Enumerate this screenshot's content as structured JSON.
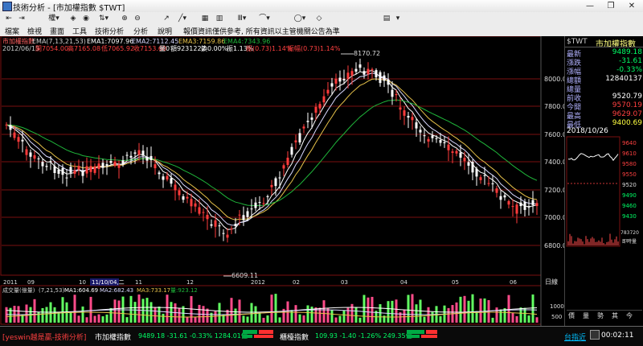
{
  "window": {
    "title": "技術分析 - [市加權指數 $TWT]",
    "min": "—",
    "max": "❐",
    "close": "✕"
  },
  "toolbar": {
    "items": [
      "⇤",
      "⇥",
      "權▾",
      "◈",
      "◉",
      "⇅▾",
      "⊕",
      "⊖",
      "↗",
      "╱▾",
      "▦",
      "▥",
      "Ⅲ▾",
      "⌒▾",
      "◯▾",
      "◇",
      "▤",
      "▾"
    ]
  },
  "menu": {
    "items": [
      "檔案",
      "檢視",
      "畫面",
      "工具",
      "技術分析",
      "分析",
      "說明",
      "報價資訊僅供參考, 所有資訊以主管機關公告為準"
    ]
  },
  "colors": {
    "up": "#ff3b3b",
    "down": "#ffffff",
    "ma1": "#ffffff",
    "ma2": "#d8d8ff",
    "ma3": "#e7c24a",
    "ma4": "#1fb53a",
    "grid": "#7a1010",
    "label": "#b2b2ff"
  },
  "price": {
    "header1": {
      "name": "市加權指數",
      "ema": "EMA(7,13,21,53)",
      "ema1": "EMA1:7097.96",
      "ema2": "EMA2:7112.45",
      "ema3": "EMA3:7159.86",
      "ema4": "EMA4:7343.96"
    },
    "header2": {
      "date": "2012/06/15",
      "open": "開7054.00",
      "high": "高7165.08",
      "low": "低7065.92",
      "close": "收7153.60",
      "vol": "量0",
      "amt": "額9231222",
      "chg": "換0.00%",
      "amp": "振1.13%",
      "ratio1": "振(0.73)1.14%",
      "ratio2": "振幅(0.73)1.14%"
    },
    "yticks": [
      "8000.0",
      "7800.0",
      "7600.0",
      "7400.0",
      "7200.0",
      "7000.0",
      "6800.0"
    ],
    "annot_high": "8170.72",
    "annot_low": "6609.11",
    "date_marker": "11/10/04,二",
    "xlabels": [
      "2011",
      "09",
      "10",
      "11",
      "12",
      "2012",
      "02",
      "03",
      "04",
      "05",
      "06"
    ],
    "unit": "日線"
  },
  "volume": {
    "header": {
      "name": "成交量(億量)",
      "params": "(7,21,53)",
      "ma1": "MA1:604.69",
      "ma2": "MA2:682.43",
      "ma3": "MA3:733.17",
      "vol": "量:923.12"
    },
    "yticks": [
      "1000",
      "500"
    ]
  },
  "quote": {
    "code": "$TWT",
    "name": "市加權指數",
    "rows": [
      {
        "k": "最新",
        "v": "9489.18",
        "c": "#00ff66"
      },
      {
        "k": "漲跌",
        "v": "-31.61",
        "c": "#00ff66"
      },
      {
        "k": "漲幅",
        "v": "-0.33%",
        "c": "#00ff66"
      },
      {
        "k": "總額",
        "v": "12840137",
        "c": "#ffffff"
      },
      {
        "k": "總量",
        "v": "",
        "c": "#ffffff"
      },
      {
        "k": "前收",
        "v": "9520.79",
        "c": "#ffffff"
      },
      {
        "k": "今開",
        "v": "9570.19",
        "c": "#ff4040"
      },
      {
        "k": "最高",
        "v": "9629.07",
        "c": "#ff4040"
      },
      {
        "k": "最低",
        "v": "9400.69",
        "c": "#ffff40"
      }
    ],
    "date": "2018/10/26",
    "mini_yticks": [
      "9640",
      "9610",
      "9580",
      "9550",
      "9520",
      "9490",
      "9460",
      "9430"
    ],
    "mini_vol": "783720",
    "mini_vol2": "即時量",
    "mini_labels": [
      "價",
      "量",
      "勢",
      "其",
      "今"
    ]
  },
  "status": {
    "brand": "[yeswin越是贏-技術分析]",
    "idx1_name": "市加權指數",
    "idx1_vals": "9489.18 -31.61 -0.33% 1284.01億",
    "idx2_name": "櫃檯指數",
    "idx2_vals": "109.93 -1.40 -1.26% 249.35億",
    "link": "台指近",
    "clock": "00:02:11"
  }
}
